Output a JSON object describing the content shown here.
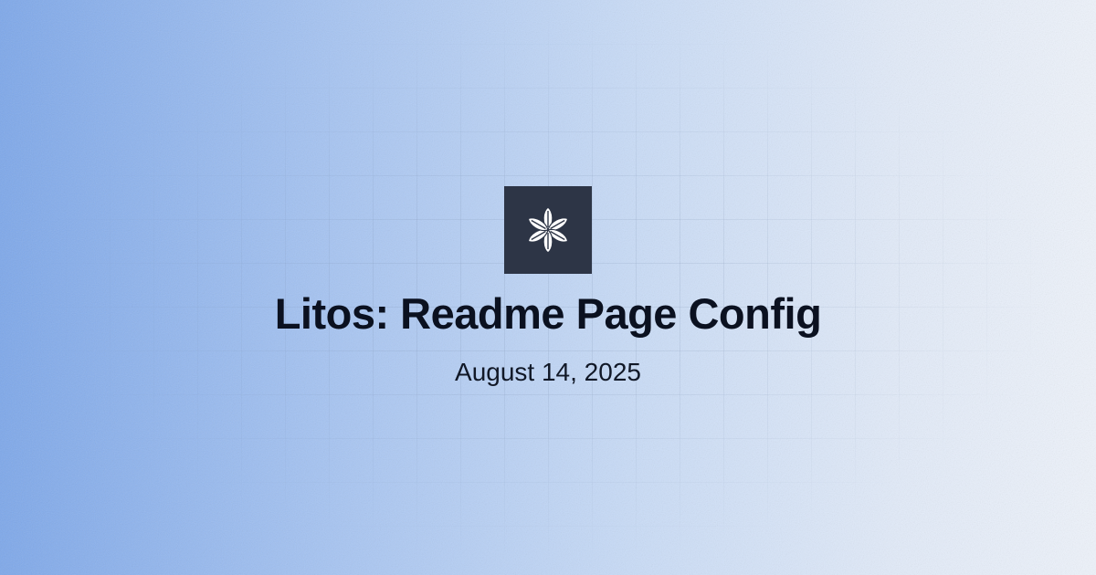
{
  "card": {
    "title": "Litos: Readme Page Config",
    "date": "August 14, 2025",
    "logo_icon": "flower-asterisk-icon"
  },
  "colors": {
    "gradient_left": "#7ea8ea",
    "gradient_right": "#eef3fb",
    "logo_background": "#2d3546",
    "logo_glyph": "#ffffff",
    "title_text": "#0b1120",
    "date_text": "#111827"
  }
}
